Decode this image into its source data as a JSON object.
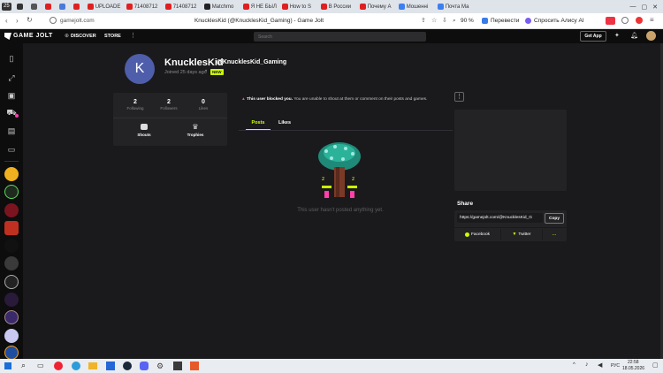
{
  "browser": {
    "tab_count": "25",
    "tabs": [
      {
        "label": "",
        "color": "#333333"
      },
      {
        "label": "",
        "color": "#555555"
      },
      {
        "label": "",
        "color": "#e02020"
      },
      {
        "label": "",
        "color": "#4a7ad9"
      },
      {
        "label": "",
        "color": "#e02020"
      },
      {
        "label": "UPLOADE",
        "color": "#e02020"
      },
      {
        "label": "71408712",
        "color": "#e02020"
      },
      {
        "label": "71408712",
        "color": "#e02020"
      },
      {
        "label": "Matchmo",
        "color": "#222222"
      },
      {
        "label": "Я НЕ БЫЛ",
        "color": "#e02020"
      },
      {
        "label": "How to S",
        "color": "#e02020"
      },
      {
        "label": "В России",
        "color": "#e02020"
      },
      {
        "label": "Почему А",
        "color": "#e02020"
      },
      {
        "label": "Мошеннi",
        "color": "#3c7ff0"
      },
      {
        "label": "Почта Ма",
        "color": "#3c7ff0"
      }
    ],
    "url": "gamejolt.com",
    "page_title": "KnucklesKid (@KnucklesKid_Gaming) - Game Jolt",
    "zoom": "90 %",
    "translate_label": "Перевести",
    "ask_alice_label": "Спросить Алису AI"
  },
  "site": {
    "logo": "GAME JOLT",
    "nav_discover": "DISCOVER",
    "nav_store": "STORE",
    "search_placeholder": "Search",
    "get_app": "Get App"
  },
  "profile": {
    "avatar_letter": "K",
    "display_name": "KnucklesKid",
    "username": "@KnucklesKid_Gaming",
    "joined": "Joined 25 days ago",
    "badge": "NEW",
    "stats": [
      {
        "value": "2",
        "label": "Following"
      },
      {
        "value": "2",
        "label": "Followers"
      },
      {
        "value": "0",
        "label": "Likes"
      }
    ],
    "shouts_label": "Shouts",
    "trophies_label": "Trophies"
  },
  "blocked": {
    "bold": "This user blocked you.",
    "text": "You are unable to shout at them or comment on their posts and games."
  },
  "tabs": {
    "posts": "Posts",
    "likes": "Likes"
  },
  "empty_text": "This user hasn't posted anything yet.",
  "share": {
    "title": "Share",
    "link": "https://gamejolt.com/@KnucklesKid_G",
    "copy": "Copy",
    "facebook": "Facebook",
    "twitter": "Twitter",
    "more": "..."
  },
  "taskbar": {
    "lang": "РУС",
    "time": "22:58",
    "date": "18.05.2026"
  },
  "colors": {
    "accent": "#ccff00",
    "accent_pink": "#ff3fac",
    "avatar_bg": "#4f5eaa"
  }
}
